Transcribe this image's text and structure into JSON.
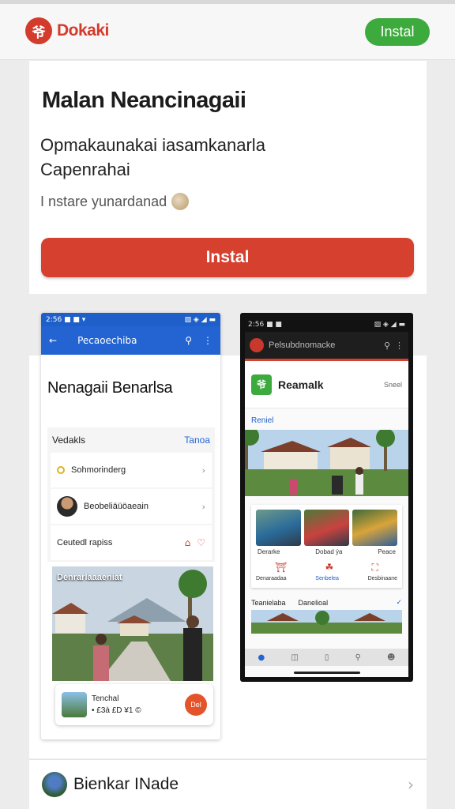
{
  "header": {
    "brand_name": "Dokaki",
    "install_label": "Instal",
    "brand_color": "#d33b2c",
    "install_color": "#3daa3d"
  },
  "hero": {
    "title": "Malan Neancinagaii",
    "description_line1": "Opmakaunakai iasamkanarla",
    "description_line2": "Capenrahai",
    "meta": "I nstare yunardanad",
    "install_button": "Instal",
    "install_color": "#d5402f"
  },
  "screenshot_left": {
    "status_left": "2:56 ■ ■ ▾",
    "status_right": "▨ ◈ ◢ ▬",
    "appbar_title": "Pecaoechiba",
    "heading": "Nenagaii Benarlsa",
    "list_header": "Vedakls",
    "list_more": "Tanoa",
    "rows": [
      {
        "label": "Sohmorinderg"
      },
      {
        "label": "Beobeliäüöaeain"
      }
    ],
    "action_row_label": "Ceutedl rapiss",
    "feature_caption": "Denrarlaaaeniat",
    "card_title": "Tenchal",
    "card_subtitle": "• £3à £D ¥1 ©",
    "card_button": "Del"
  },
  "screenshot_right": {
    "status_left": "2:56 ■ ■",
    "status_right": "▨ ◈ ◢ ▬",
    "appbar_title": "Pelsubdnomacke",
    "app_name": "Reamalk",
    "header_small": "Sneel",
    "section_label": "Reniel",
    "thumb_labels": [
      "Derarke",
      "Dobad ýa",
      "Peace"
    ],
    "icon_labels": [
      "Denaraadaa",
      "Senbelea",
      "Desbinaane"
    ],
    "footer_left": "Teanielaba",
    "footer_right": "Danelioal"
  },
  "bottom_item": {
    "label": "Bienkar INade"
  }
}
